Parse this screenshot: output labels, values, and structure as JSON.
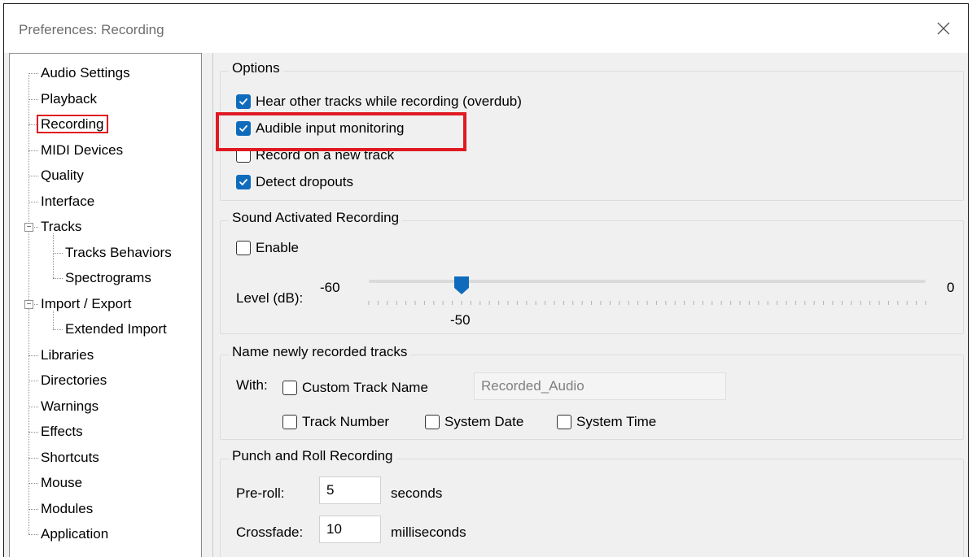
{
  "window": {
    "title": "Preferences: Recording",
    "close_icon": "close-icon"
  },
  "tree": {
    "items": [
      {
        "label": "Audio Settings"
      },
      {
        "label": "Playback"
      },
      {
        "label": "Recording",
        "selected": true
      },
      {
        "label": "MIDI Devices"
      },
      {
        "label": "Quality"
      },
      {
        "label": "Interface"
      },
      {
        "label": "Tracks",
        "expandable": true,
        "expanded": true
      },
      {
        "label": "Tracks Behaviors",
        "child": true
      },
      {
        "label": "Spectrograms",
        "child": true
      },
      {
        "label": "Import / Export",
        "expandable": true,
        "expanded": true
      },
      {
        "label": "Extended Import",
        "child": true
      },
      {
        "label": "Libraries"
      },
      {
        "label": "Directories"
      },
      {
        "label": "Warnings"
      },
      {
        "label": "Effects"
      },
      {
        "label": "Shortcuts"
      },
      {
        "label": "Mouse"
      },
      {
        "label": "Modules"
      },
      {
        "label": "Application"
      }
    ]
  },
  "options": {
    "title": "Options",
    "overdub": {
      "label": "Hear other tracks while recording (overdub)",
      "checked": true
    },
    "monitoring": {
      "label": "Audible input monitoring",
      "checked": true
    },
    "new_track": {
      "label": "Record on a new track",
      "checked": false
    },
    "dropouts": {
      "label": "Detect dropouts",
      "checked": true
    }
  },
  "sound_activated": {
    "title": "Sound Activated Recording",
    "enable": {
      "label": "Enable",
      "checked": false
    },
    "level_label": "Level (dB):",
    "min_label": "-60",
    "max_label": "0",
    "value_label": "-50",
    "min": -60,
    "max": 0,
    "value": -50
  },
  "naming": {
    "title": "Name newly recorded tracks",
    "with_label": "With:",
    "custom": {
      "label": "Custom Track Name",
      "checked": false
    },
    "custom_value": "Recorded_Audio",
    "track_number": {
      "label": "Track Number",
      "checked": false
    },
    "system_date": {
      "label": "System Date",
      "checked": false
    },
    "system_time": {
      "label": "System Time",
      "checked": false
    }
  },
  "punch_roll": {
    "title": "Punch and Roll Recording",
    "preroll_label": "Pre-roll:",
    "preroll_value": "5",
    "preroll_unit": "seconds",
    "crossfade_label": "Crossfade:",
    "crossfade_value": "10",
    "crossfade_unit": "milliseconds"
  },
  "colors": {
    "accent": "#0f6cbd",
    "highlight": "#e01a22"
  }
}
